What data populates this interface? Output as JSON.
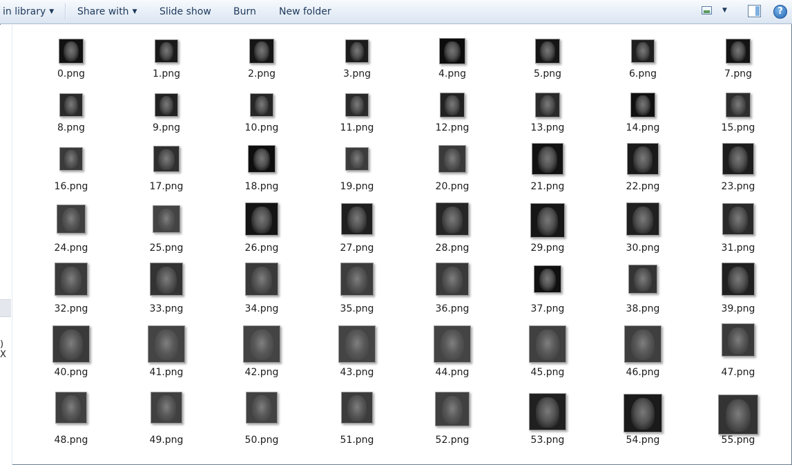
{
  "toolbar": {
    "items": [
      {
        "label": "in library",
        "caret": true
      },
      {
        "label": "Share with",
        "caret": true
      },
      {
        "label": "Slide show",
        "caret": false
      },
      {
        "label": "Burn",
        "caret": false
      },
      {
        "label": "New folder",
        "caret": false
      }
    ],
    "caret_glyph": "▼"
  },
  "nav": {
    "cutoff_text": ") X"
  },
  "files": [
    "0.png",
    "1.png",
    "2.png",
    "3.png",
    "4.png",
    "5.png",
    "6.png",
    "7.png",
    "8.png",
    "9.png",
    "10.png",
    "11.png",
    "12.png",
    "13.png",
    "14.png",
    "15.png",
    "16.png",
    "17.png",
    "18.png",
    "19.png",
    "20.png",
    "21.png",
    "22.png",
    "23.png",
    "24.png",
    "25.png",
    "26.png",
    "27.png",
    "28.png",
    "29.png",
    "30.png",
    "31.png",
    "32.png",
    "33.png",
    "34.png",
    "35.png",
    "36.png",
    "37.png",
    "38.png",
    "39.png",
    "40.png",
    "41.png",
    "42.png",
    "43.png",
    "44.png",
    "45.png",
    "46.png",
    "47.png",
    "48.png",
    "49.png",
    "50.png",
    "51.png",
    "52.png",
    "53.png",
    "54.png",
    "55.png"
  ],
  "colors": {
    "thumb_dark": "#0f0f0f",
    "thumb_mid": "#333333",
    "thumb_light": "#4a4a4a",
    "text": "#1b1b1b",
    "toolbar_text": "#1e395b"
  }
}
